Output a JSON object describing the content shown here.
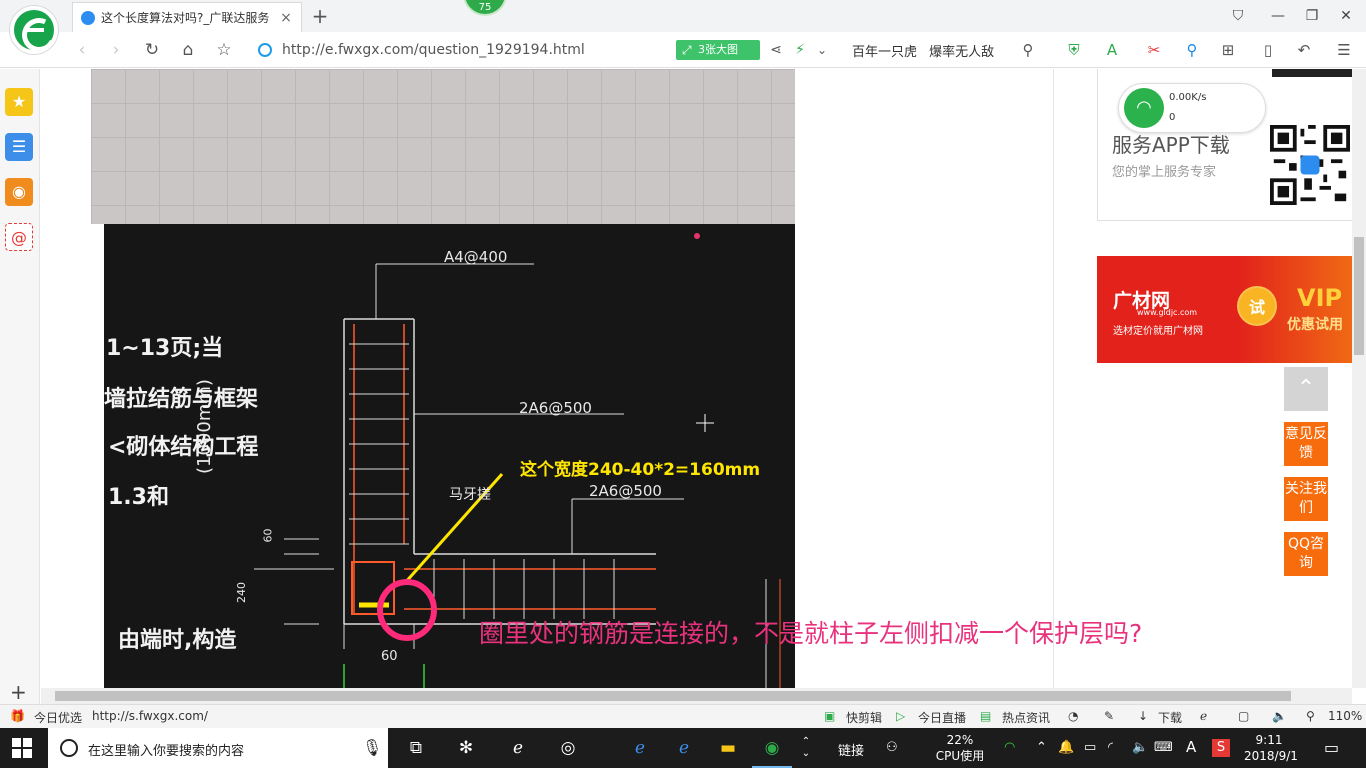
{
  "browser": {
    "tab_title": "这个长度算法对吗?_广联达服务",
    "tab_close": "×",
    "new_tab": "+",
    "badge_count": "75",
    "url": "http://e.fwxgx.com/question_1929194.html",
    "big_picture_label": "3张大图",
    "hot_search": [
      "百年一只虎",
      "爆率无人敌"
    ],
    "window_buttons": [
      "minimize",
      "maximize",
      "close"
    ]
  },
  "photo": {
    "cad_labels": {
      "a4": "A4@400",
      "a6_top": "2A6@500",
      "a6_mid": "2A6@500",
      "mayacha": "马牙搓",
      "dim_60_left": "60",
      "dim_240": "240",
      "dim_60_bottom": "60",
      "dim_1000": "(1000mm)"
    },
    "side_text": [
      "1~13页;当",
      "墙拉结筋与框架",
      "<砌体结构工程",
      "1.3和",
      "由端时,构造"
    ],
    "yellow_note": "这个宽度240-40*2=160mm",
    "question": "圈里处的钢筋是连接的，不是就柱子左侧扣减一个保护层吗?"
  },
  "right": {
    "net_speed": "0.00K/s",
    "net_count": "0",
    "app_title": "服务APP下载",
    "app_sub": "您的掌上服务专家",
    "ad": {
      "brand": "广材网",
      "domain": "www.gldjc.com",
      "slogan": "选材定价就用广材网",
      "try": "试",
      "vip": "VIP",
      "vip_sub": "优惠试用"
    },
    "float_buttons": [
      "意见反馈",
      "关注我们",
      "QQ咨询"
    ]
  },
  "statusbar": {
    "left_label": "今日优选",
    "hover_url": "http://s.fwxgx.com/",
    "kuaijianji": "快剪辑",
    "live": "今日直播",
    "news": "热点资讯",
    "download": "下载",
    "zoom": "110%"
  },
  "taskbar": {
    "search_placeholder": "在这里输入你要搜索的内容",
    "link_label": "链接",
    "cpu_percent": "22%",
    "cpu_label": "CPU使用",
    "ime": "A",
    "time": "9:11",
    "date": "2018/9/1"
  },
  "colors": {
    "accent_green": "#2eaa4a",
    "ad_red": "#e2221b",
    "float_orange": "#f76c0c",
    "question_pink": "#e8327d",
    "note_yellow": "#ffe600"
  }
}
